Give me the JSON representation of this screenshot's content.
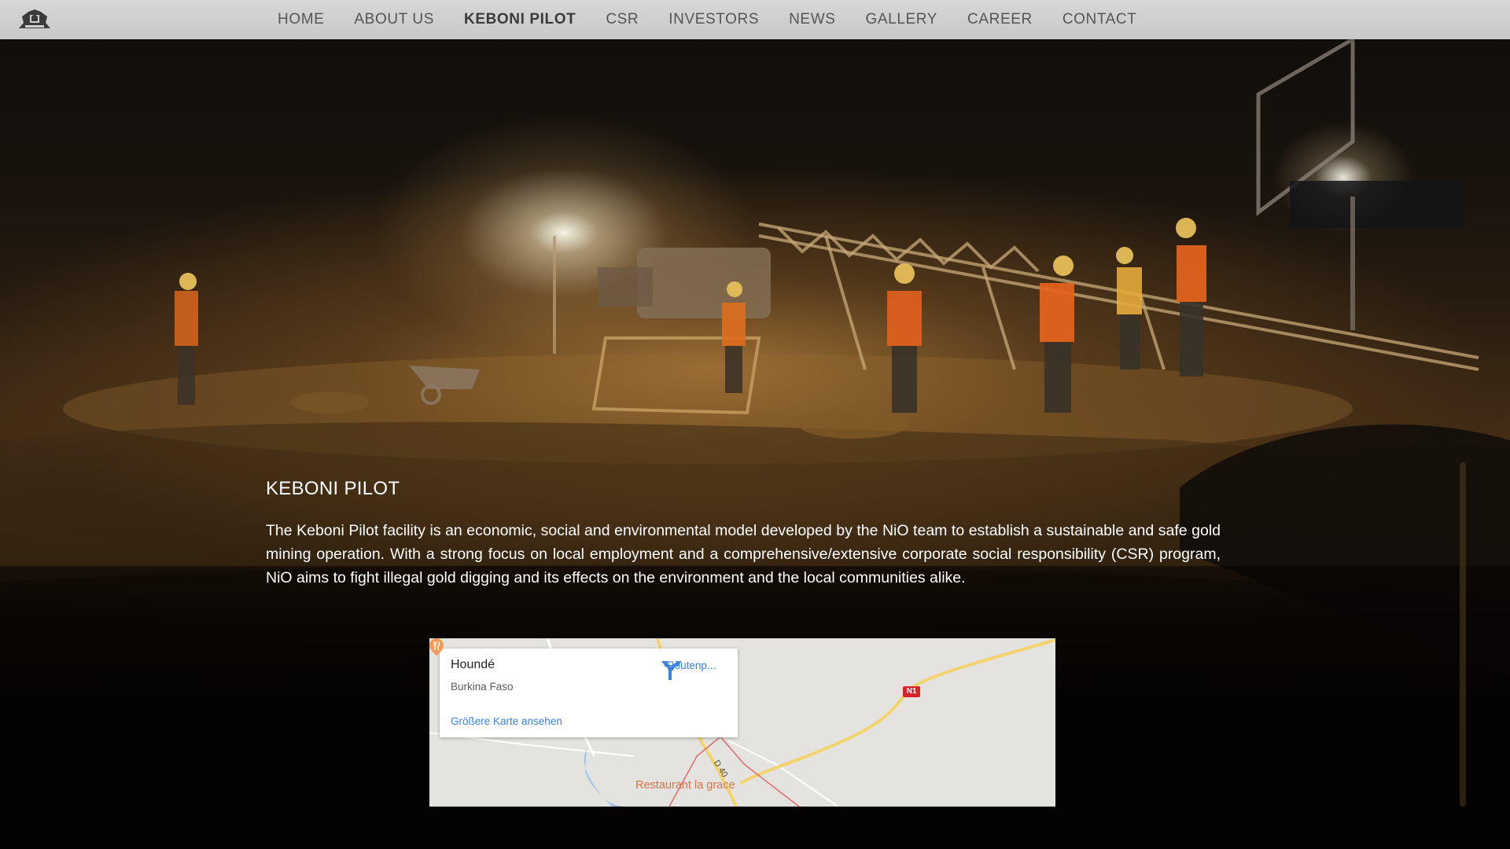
{
  "nav": {
    "items": [
      {
        "label": "HOME",
        "active": false
      },
      {
        "label": "ABOUT US",
        "active": false
      },
      {
        "label": "KEBONI PILOT",
        "active": true
      },
      {
        "label": "CSR",
        "active": false
      },
      {
        "label": "INVESTORS",
        "active": false
      },
      {
        "label": "NEWS",
        "active": false
      },
      {
        "label": "GALLERY",
        "active": false
      },
      {
        "label": "CAREER",
        "active": false
      },
      {
        "label": "CONTACT",
        "active": false
      }
    ]
  },
  "content": {
    "title": "KEBONI PILOT",
    "body": "The Keboni Pilot facility is an economic, social and environmental model developed by the NiO team to establish a sustainable and safe gold mining operation. With a strong focus on local employment and a comprehensive/extensive corporate social responsibility (CSR) program, NiO aims to fight illegal gold digging and its effects on the environment and the local communities alike."
  },
  "map": {
    "place_name": "Houndé",
    "region": "Burkina Faso",
    "directions_label": "Routenp...",
    "larger_map_link": "Größere Karte ansehen",
    "road_badge": "N1",
    "road_label": "D 40",
    "poi_label": "Restaurant la grace"
  },
  "colors": {
    "nav_background": "#cfcfcf",
    "nav_text": "#555555",
    "link_blue": "#3a84df",
    "road_badge_red": "#d8232a",
    "map_land": "#e5e3df",
    "road_yellow": "#f3d36b",
    "water_blue": "#a4c4e8"
  },
  "icons": {
    "logo": "lion-crest-logo",
    "directions": "directions-arrow-icon",
    "poi": "restaurant-pin-icon"
  }
}
